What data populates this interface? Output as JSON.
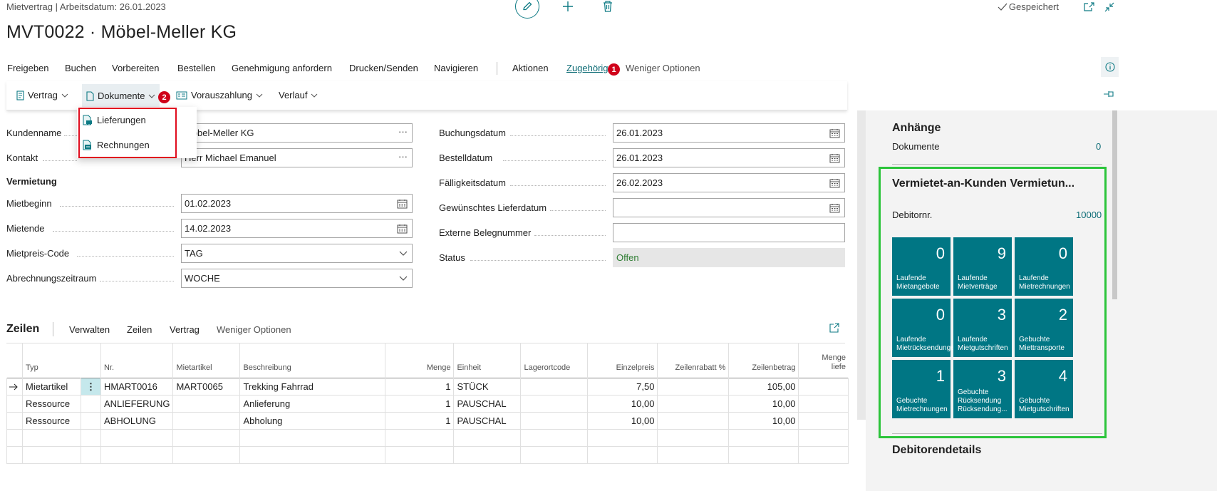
{
  "header": {
    "breadcrumb": "Mietvertrag | Arbeitsdatum: 26.01.2023",
    "title": "MVT0022 · Möbel-Meller KG",
    "saved_label": "Gespeichert"
  },
  "actions": {
    "items": [
      "Freigeben",
      "Buchen",
      "Vorbereiten",
      "Bestellen",
      "Genehmigung anfordern",
      "Drucken/Senden",
      "Navigieren"
    ],
    "aktionen": "Aktionen",
    "zugehoerig": "Zugehörig",
    "weniger": "Weniger Optionen",
    "badge1": "1",
    "badge2": "2"
  },
  "subtabs": {
    "vertrag": "Vertrag",
    "dokumente": "Dokumente",
    "vorauszahlung": "Vorauszahlung",
    "verlauf": "Verlauf"
  },
  "dropdown": {
    "items": [
      "Lieferungen",
      "Rechnungen"
    ]
  },
  "form": {
    "kundenname_label": "Kundenname",
    "kundenname_value": "Möbel-Meller KG",
    "kontakt_label": "Kontakt",
    "kontakt_value": "Herr Michael Emanuel",
    "vermietung_heading": "Vermietung",
    "mietbeginn_label": "Mietbeginn",
    "mietbeginn_value": "01.02.2023",
    "mietende_label": "Mietende",
    "mietende_value": "14.02.2023",
    "mietpreis_label": "Mietpreis-Code",
    "mietpreis_value": "TAG",
    "abrechnung_label": "Abrechnungszeitraum",
    "abrechnung_value": "WOCHE",
    "buchungsdatum_label": "Buchungsdatum",
    "buchungsdatum_value": "26.01.2023",
    "bestelldatum_label": "Bestelldatum",
    "bestelldatum_value": "26.01.2023",
    "faelligkeit_label": "Fälligkeitsdatum",
    "faelligkeit_value": "26.02.2023",
    "lieferdatum_label": "Gewünschtes Lieferdatum",
    "lieferdatum_value": "",
    "externe_label": "Externe Belegnummer",
    "externe_value": "",
    "status_label": "Status",
    "status_value": "Offen"
  },
  "lines": {
    "heading": "Zeilen",
    "tabs": [
      "Verwalten",
      "Zeilen",
      "Vertrag"
    ],
    "weniger": "Weniger Optionen",
    "columns": [
      "Typ",
      "Nr.",
      "Mietartikel",
      "Beschreibung",
      "Menge",
      "Einheit",
      "Lagerortcode",
      "Einzelpreis",
      "Zeilenrabatt %",
      "Zeilenbetrag"
    ],
    "col_menge_liefern_1": "Menge",
    "col_menge_liefern_2": "liefe",
    "rows": [
      {
        "typ": "Mietartikel",
        "nr": "HMART0016",
        "mietartikel": "MART0065",
        "beschreibung": "Trekking Fahrrad",
        "menge": "1",
        "einheit": "STÜCK",
        "lager": "",
        "preis": "7,50",
        "rabatt": "",
        "betrag": "105,00"
      },
      {
        "typ": "Ressource",
        "nr": "ANLIEFERUNG",
        "mietartikel": "",
        "beschreibung": "Anlieferung",
        "menge": "1",
        "einheit": "PAUSCHAL",
        "lager": "",
        "preis": "10,00",
        "rabatt": "",
        "betrag": "10,00"
      },
      {
        "typ": "Ressource",
        "nr": "ABHOLUNG",
        "mietartikel": "",
        "beschreibung": "Abholung",
        "menge": "1",
        "einheit": "PAUSCHAL",
        "lager": "",
        "preis": "10,00",
        "rabatt": "",
        "betrag": "10,00"
      }
    ]
  },
  "factbox": {
    "anhaenge_title": "Anhänge",
    "dokumente_label": "Dokumente",
    "dokumente_value": "0",
    "vermietet_title": "Vermietet-an-Kunden Vermietun...",
    "debitor_label": "Debitornr.",
    "debitor_value": "10000",
    "tiles": [
      {
        "value": "0",
        "label": "Laufende Mietangebote"
      },
      {
        "value": "9",
        "label": "Laufende Mietverträge"
      },
      {
        "value": "0",
        "label": "Laufende Mietrechnungen"
      },
      {
        "value": "0",
        "label": "Laufende Mietrücksendungen"
      },
      {
        "value": "3",
        "label": "Laufende Mietgutschriften"
      },
      {
        "value": "2",
        "label": "Gebuchte Miettransporte"
      },
      {
        "value": "1",
        "label": "Gebuchte Mietrechnungen"
      },
      {
        "value": "3",
        "label": "Gebuchte Rücksendung Rücksendung..."
      },
      {
        "value": "4",
        "label": "Gebuchte Mietgutschriften"
      }
    ],
    "debitorendetails_title": "Debitorendetails"
  },
  "colors": {
    "accent": "#007684",
    "badge": "#d0021b",
    "highlight_red": "#e00c1e",
    "highlight_green": "#2bc43a",
    "status_green": "#2e7d32"
  }
}
